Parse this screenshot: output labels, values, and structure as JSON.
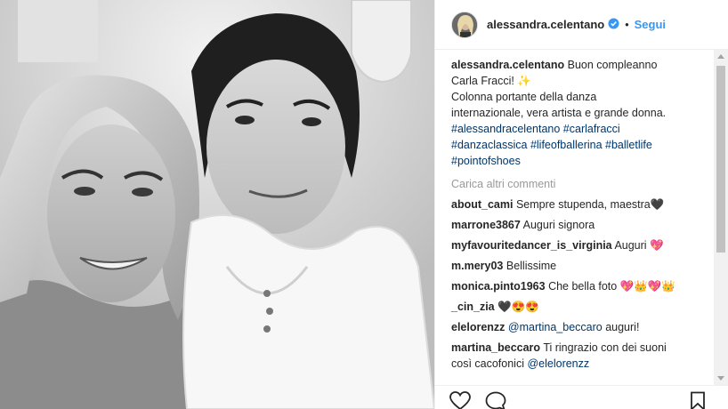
{
  "post": {
    "username": "alessandra.celentano",
    "follow_label": "Segui",
    "separator": "•",
    "caption": {
      "username": "alessandra.celentano",
      "line1": "Buon compleanno",
      "line2": "Carla Fracci! ✨",
      "line3": "Colonna portante della danza",
      "line4": "internazionale, vera artista e grande donna.",
      "hashtags_line1": "#alessandracelentano #carlafracci",
      "hashtags_line2": "#danzaclassica #lifeofballerina #balletlife",
      "hashtags_line3": "#pointofshoes"
    },
    "load_more": "Carica altri commenti",
    "comments": [
      {
        "user": "about_cami",
        "text": "Sempre stupenda, maestra🖤"
      },
      {
        "user": "marrone3867",
        "text": "Auguri signora"
      },
      {
        "user": "myfavouritedancer_is_virginia",
        "text": "Auguri 💖"
      },
      {
        "user": "m.mery03",
        "text": "Bellissime"
      },
      {
        "user": "monica.pinto1963",
        "text": "Che bella foto 💖👑💖👑"
      },
      {
        "user": "_cin_zia",
        "text": "🖤😍😍"
      },
      {
        "user": "elelorenzz",
        "mention": "@martina_beccaro",
        "text": " auguri!"
      },
      {
        "user": "martina_beccaro",
        "text": "Ti ringrazio con dei suoni",
        "text2": "così cacofonici ",
        "mention": "@elelorenzz"
      }
    ]
  },
  "icons": {
    "verified": "verified-badge-icon",
    "like": "heart-icon",
    "comment": "comment-bubble-icon",
    "save": "bookmark-icon"
  },
  "colors": {
    "link": "#003569",
    "follow": "#3897f0",
    "verified": "#3897f0",
    "muted": "#999999"
  }
}
